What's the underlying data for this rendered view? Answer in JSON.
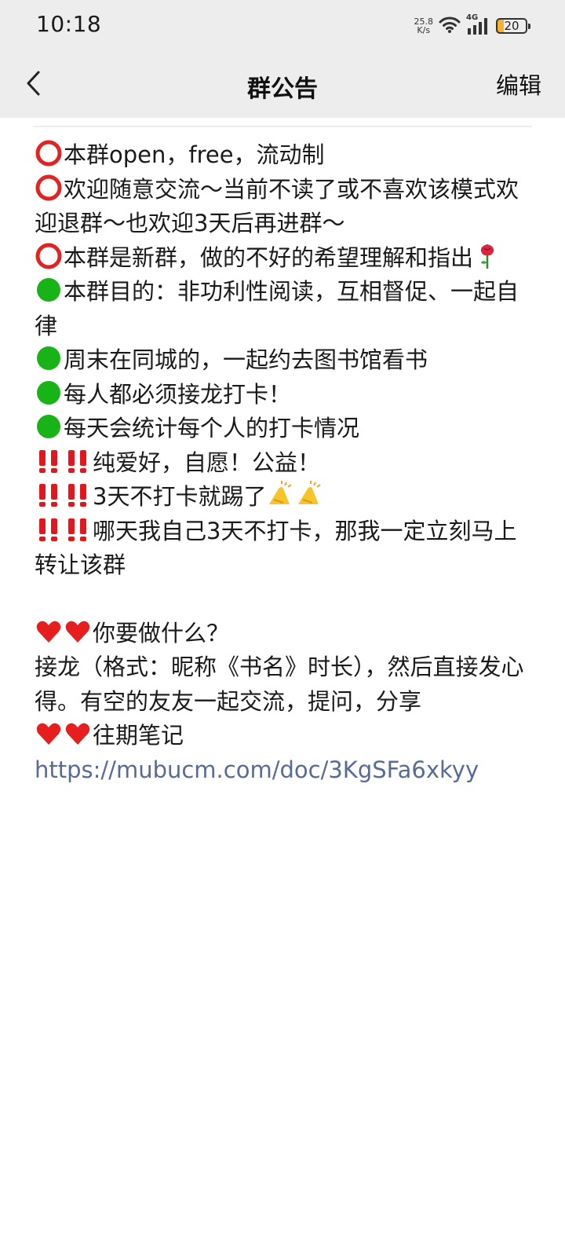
{
  "status_bar": {
    "time": "10:18",
    "net_speed_value": "25.8",
    "net_speed_unit": "K/s",
    "network_type": "4G",
    "battery_level": "20"
  },
  "header": {
    "title": "群公告",
    "edit_label": "编辑"
  },
  "announcement": {
    "lines": [
      "本群open，free，流动制",
      "欢迎随意交流～当前不读了或不喜欢该模式欢迎退群～也欢迎3天后再进群～",
      "本群是新群，做的不好的希望理解和指出",
      "本群目的：非功利性阅读，互相督促、一起自律",
      "周末在同城的，一起约去图书馆看书",
      "每人都必须接龙打卡！",
      "每天会统计每个人的打卡情况",
      "纯爱好，自愿！公益！",
      "3天不打卡就踢了",
      "哪天我自己3天不打卡，那我一定立刻马上转让该群",
      "你要做什么？",
      "接龙（格式：昵称《书名》时长），然后直接发心得。有空的友友一起交流，提问，分享",
      "往期笔记",
      "https://mubucm.com/doc/3KgSFa6xkyy"
    ]
  },
  "colors": {
    "red_circle": "#e02424",
    "green_circle": "#17b317",
    "double_bang": "#e0171f",
    "heart": "#e61e1e",
    "link": "#576b95",
    "header_bg": "#ededed"
  },
  "icons": [
    "back-chevron-icon",
    "wifi-icon",
    "signal-icon",
    "battery-icon",
    "red-circle-icon",
    "green-circle-icon",
    "double-exclamation-icon",
    "rose-icon",
    "raised-hands-icon",
    "heart-icon"
  ]
}
